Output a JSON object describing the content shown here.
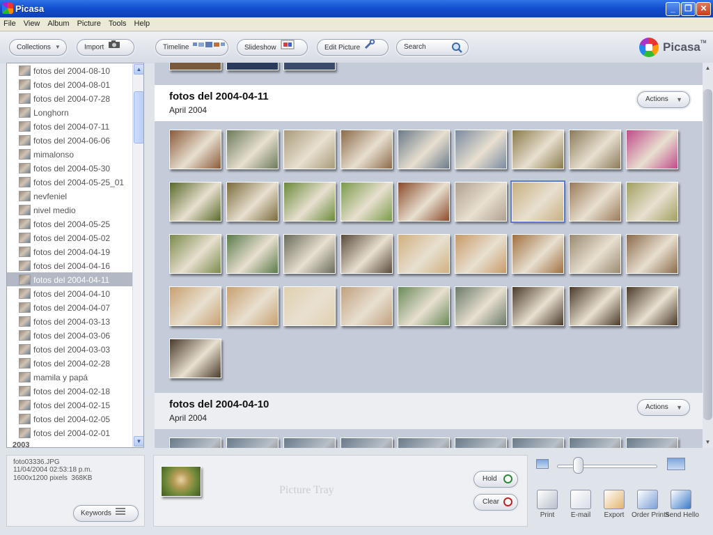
{
  "window": {
    "title": "Picasa"
  },
  "menu": [
    "File",
    "View",
    "Album",
    "Picture",
    "Tools",
    "Help"
  ],
  "toolbar": {
    "collections": "Collections",
    "import": "Import",
    "timeline": "Timeline",
    "slideshow": "Slideshow",
    "edit_picture": "Edit Picture",
    "search": "Search",
    "brand": "Picasa",
    "brand_tm": "TM"
  },
  "folders": [
    {
      "name": "fotos del 2004-08-10"
    },
    {
      "name": "fotos del 2004-08-01"
    },
    {
      "name": "fotos del 2004-07-28"
    },
    {
      "name": "Longhorn"
    },
    {
      "name": "fotos del 2004-07-11"
    },
    {
      "name": "fotos del 2004-06-06"
    },
    {
      "name": "mimalonso"
    },
    {
      "name": "fotos del 2004-05-30"
    },
    {
      "name": "fotos del 2004-05-25_01"
    },
    {
      "name": "nevfeniel"
    },
    {
      "name": "nivel medio"
    },
    {
      "name": "fotos del 2004-05-25"
    },
    {
      "name": "fotos del 2004-05-02"
    },
    {
      "name": "fotos del 2004-04-19"
    },
    {
      "name": "fotos del 2004-04-16"
    },
    {
      "name": "fotos del 2004-04-11",
      "selected": true
    },
    {
      "name": "fotos del 2004-04-10"
    },
    {
      "name": "fotos del 2004-04-07"
    },
    {
      "name": "fotos del 2004-03-13"
    },
    {
      "name": "fotos del 2004-03-06"
    },
    {
      "name": "fotos del 2004-03-03"
    },
    {
      "name": "fotos del 2004-02-28"
    },
    {
      "name": "mamila y papá"
    },
    {
      "name": "fotos del 2004-02-18"
    },
    {
      "name": "fotos del 2004-02-15"
    },
    {
      "name": "fotos del 2004-02-05"
    },
    {
      "name": "fotos del 2004-02-01"
    }
  ],
  "folders_year": "2003",
  "groups": [
    {
      "title": "fotos del 2004-04-11",
      "date": "April 2004",
      "actions": "Actions"
    },
    {
      "title": "fotos del 2004-04-10",
      "date": "April 2004",
      "actions": "Actions"
    }
  ],
  "photo_colors": [
    [
      "#8a5a3a",
      "#6c7a5a",
      "#a89a7a",
      "#8b6a4a",
      "#6a7a8a",
      "#7a8aa0",
      "#8a7a4a",
      "#8a7a5a",
      "#c04a8a"
    ],
    [
      "#5a6a2a",
      "#7a6a3a",
      "#6a8a3a",
      "#7a9a4a",
      "#8a4a2a",
      "#b0a090",
      "#c8b080",
      "#9a7a5a",
      "#a0a060"
    ],
    [
      "#7a8a4a",
      "#5a7a4a",
      "#6a6a5a",
      "#5a4a3a",
      "#d0b080",
      "#c89a6a",
      "#a07040",
      "#9a8a70",
      "#8a6a4a"
    ],
    [
      "#c8a070",
      "#c8a070",
      "#e0d0b0",
      "#c0a080",
      "#6a8a5a",
      "#6a7a6a",
      "#4a3a2a",
      "#4a3a2a",
      "#4a3a2a"
    ],
    [
      "#4a3a2a"
    ]
  ],
  "selected_photo": {
    "row": 1,
    "col": 6
  },
  "info": {
    "filename": "foto03336.JPG",
    "datetime": "11/04/2004 02:53:18 p.m.",
    "size": "1600x1200 pixels",
    "filesize": "368KB",
    "keywords": "Keywords"
  },
  "tray": {
    "label": "Picture Tray",
    "hold": "Hold",
    "clear": "Clear"
  },
  "export": [
    {
      "label": "Print",
      "color": "#b8c0cc"
    },
    {
      "label": "E-mail",
      "color": "#d8dde6"
    },
    {
      "label": "Export",
      "color": "#e2b46a"
    },
    {
      "label": "Order Prints",
      "color": "#7aa0d8"
    },
    {
      "label": "Send Hello",
      "color": "#3a7ac8"
    }
  ]
}
